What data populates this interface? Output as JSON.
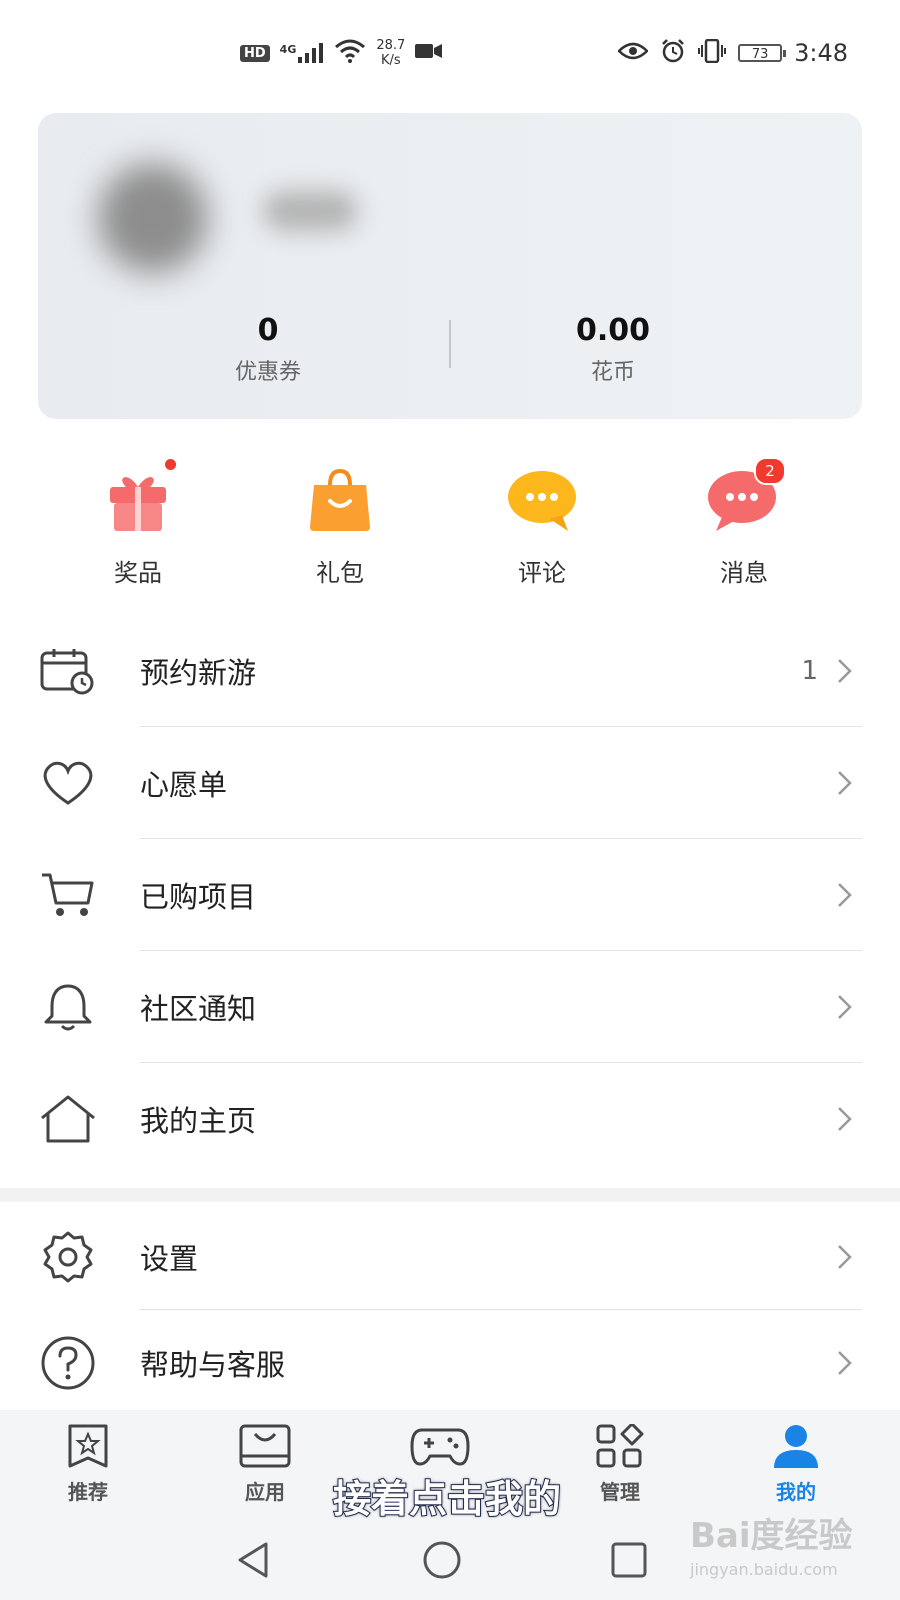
{
  "status_bar": {
    "hd_badge": "HD",
    "network": "4G",
    "speed_value": "28.7",
    "speed_unit": "K/s",
    "battery": "73",
    "time": "3:48"
  },
  "profile": {
    "stats": [
      {
        "value": "0",
        "label": "优惠券"
      },
      {
        "value": "0.00",
        "label": "花币"
      }
    ]
  },
  "quick_actions": [
    {
      "label": "奖品",
      "icon": "gift-icon",
      "dot": true
    },
    {
      "label": "礼包",
      "icon": "shopping-bag-icon"
    },
    {
      "label": "评论",
      "icon": "comment-bubble-icon"
    },
    {
      "label": "消息",
      "icon": "message-bubble-icon",
      "badge": "2"
    }
  ],
  "menu_group1": [
    {
      "label": "预约新游",
      "count": "1",
      "icon": "calendar-clock-icon"
    },
    {
      "label": "心愿单",
      "icon": "heart-icon"
    },
    {
      "label": "已购项目",
      "icon": "cart-icon"
    },
    {
      "label": "社区通知",
      "icon": "bell-icon"
    },
    {
      "label": "我的主页",
      "icon": "home-icon"
    }
  ],
  "menu_group2": [
    {
      "label": "设置",
      "icon": "gear-icon"
    },
    {
      "label": "帮助与客服",
      "icon": "help-circle-icon"
    }
  ],
  "tabs": [
    {
      "label": "推荐",
      "icon": "star-bookmark-icon"
    },
    {
      "label": "应用",
      "icon": "app-bag-icon"
    },
    {
      "label": "",
      "icon": "gamepad-icon"
    },
    {
      "label": "管理",
      "icon": "grid-manage-icon"
    },
    {
      "label": "我的",
      "icon": "person-icon",
      "active": true
    }
  ],
  "caption": "接着点击我的",
  "watermark": {
    "logo": "Bai度经验",
    "url": "jingyan.baidu.com"
  },
  "colors": {
    "accent": "#1a83e6",
    "badge_red": "#f03a2e"
  }
}
